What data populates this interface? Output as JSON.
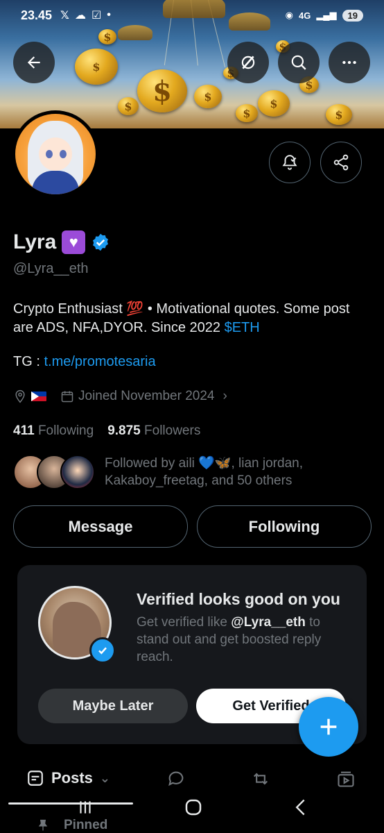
{
  "status_bar": {
    "time": "23.45",
    "network": "4G",
    "battery": "19"
  },
  "header": {
    "back_label": "Back",
    "grok_label": "Grok",
    "search_label": "Search",
    "more_label": "More"
  },
  "profile": {
    "name": "Lyra",
    "handle": "@Lyra__eth",
    "bio_text": "Crypto Enthusiast 💯 • Motivational quotes. Some post are ADS, NFA,DYOR. Since 2022 ",
    "bio_cashtag": "$ETH",
    "tg_label": "TG : ",
    "tg_link": "t.me/promotesaria",
    "joined": "Joined November 2024",
    "following_count": "411",
    "following_label": "Following",
    "followers_count": "9.875",
    "followers_label": "Followers",
    "followed_by": "Followed by aili 💙🦋, lian jordan, Kakaboy_freetag, and 50 others"
  },
  "actions": {
    "message": "Message",
    "following": "Following"
  },
  "verified_card": {
    "title": "Verified looks good on you",
    "text_prefix": "Get verified like ",
    "text_handle": "@Lyra__eth",
    "text_suffix": " to stand out and get boosted reply reach.",
    "maybe_later": "Maybe Later",
    "get_verified": "Get Verified"
  },
  "tabs": {
    "posts": "Posts"
  },
  "pinned": {
    "label": "Pinned"
  },
  "colors": {
    "accent": "#1d9bf0",
    "background": "#000000",
    "muted": "#71767b"
  }
}
